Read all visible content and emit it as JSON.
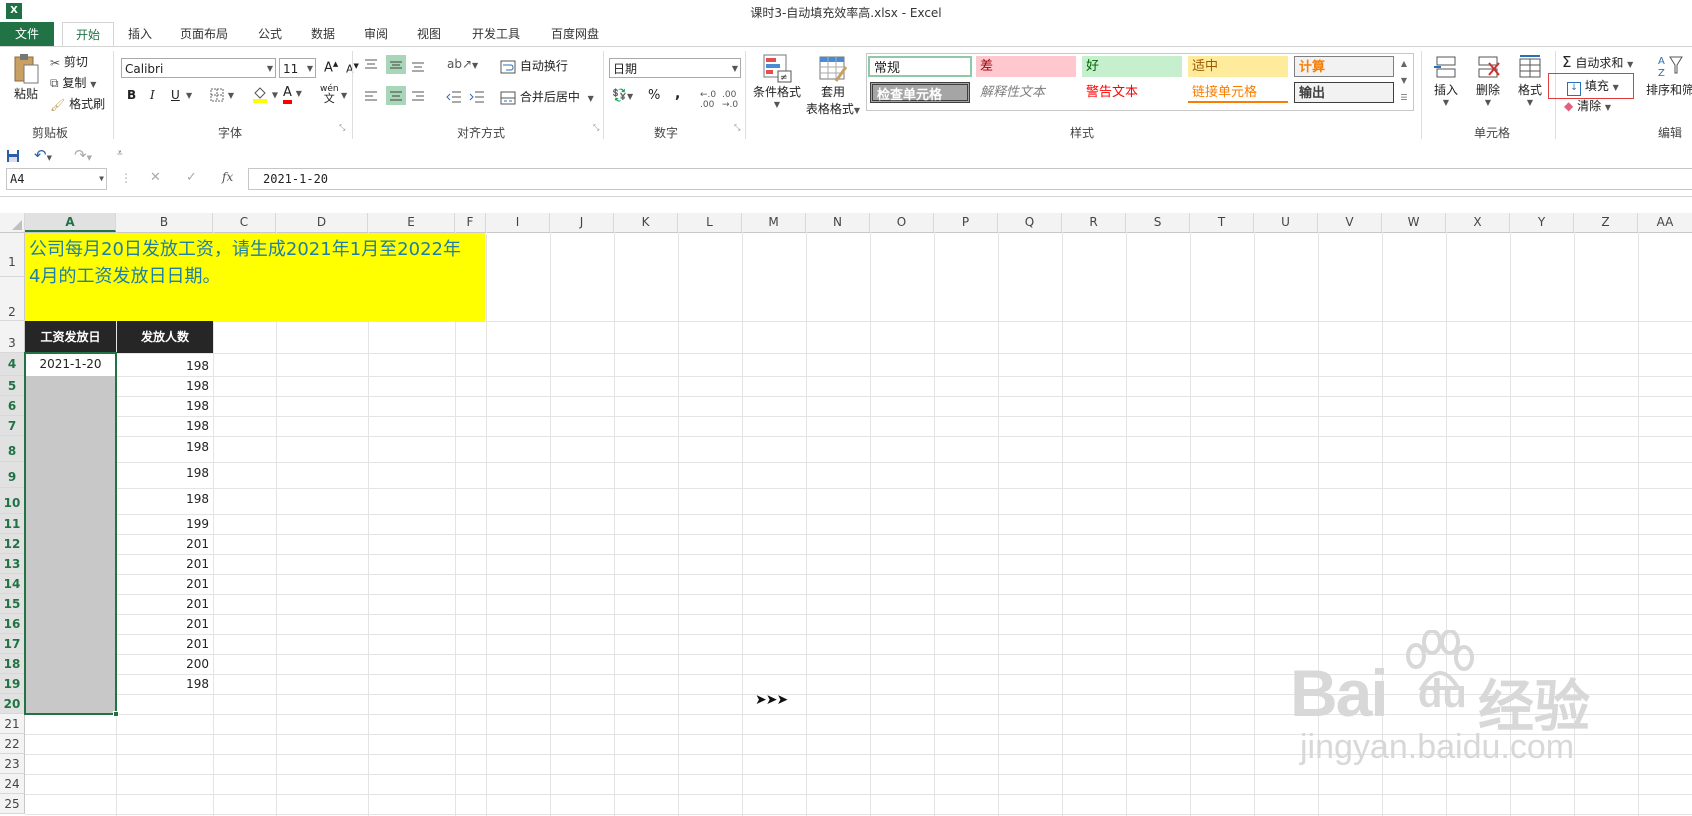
{
  "window": {
    "title": "课时3-自动填充效率高.xlsx - Excel",
    "app_icon": "X"
  },
  "tabs": [
    "文件",
    "开始",
    "插入",
    "页面布局",
    "公式",
    "数据",
    "审阅",
    "视图",
    "开发工具",
    "百度网盘"
  ],
  "ribbon": {
    "clipboard": {
      "paste": "粘贴",
      "cut": "剪切",
      "copy": "复制",
      "format_painter": "格式刷",
      "group": "剪贴板"
    },
    "font": {
      "name": "Calibri",
      "size": "11",
      "bold": "B",
      "italic": "I",
      "underline": "U",
      "grow": "A",
      "shrink": "A",
      "font_color_letter": "A",
      "phonetic": "wén",
      "group": "字体"
    },
    "alignment": {
      "wrap": "自动换行",
      "merge": "合并后居中",
      "group": "对齐方式"
    },
    "number": {
      "format": "日期",
      "percent": "%",
      "comma": ",",
      "group": "数字"
    },
    "styles": {
      "conditional": "条件格式",
      "table_line1": "套用",
      "table_line2": "表格格式",
      "cells": [
        {
          "label": "常规",
          "bg": "#ffffff",
          "fg": "#000000"
        },
        {
          "label": "差",
          "bg": "#ffc7ce",
          "fg": "#9c0006"
        },
        {
          "label": "好",
          "bg": "#c6efce",
          "fg": "#006100"
        },
        {
          "label": "适中",
          "bg": "#ffeb9c",
          "fg": "#9c5700"
        },
        {
          "label": "计算",
          "bg": "#f2f2f2",
          "fg": "#fa7d00"
        },
        {
          "label": "检查单元格",
          "bg": "#a5a5a5",
          "fg": "#ffffff"
        },
        {
          "label": "解释性文本",
          "bg": "#ffffff",
          "fg": "#7f7f7f"
        },
        {
          "label": "警告文本",
          "bg": "#ffffff",
          "fg": "#ff0000"
        },
        {
          "label": "链接单元格",
          "bg": "#ffffff",
          "fg": "#fa7d00"
        },
        {
          "label": "输出",
          "bg": "#f2f2f2",
          "fg": "#3f3f3f"
        }
      ],
      "group": "样式"
    },
    "cells": {
      "insert": "插入",
      "delete": "删除",
      "format": "格式",
      "group": "单元格"
    },
    "editing": {
      "autosum": "自动求和",
      "fill": "填充",
      "clear": "清除",
      "sort": "排序和筛",
      "group": "编辑"
    }
  },
  "formula_bar": {
    "name_box": "A4",
    "fx": "fx",
    "value": "2021-1-20"
  },
  "columns": [
    "A",
    "B",
    "C",
    "D",
    "E",
    "F",
    "I",
    "J",
    "K",
    "L",
    "M",
    "N",
    "O",
    "P",
    "Q",
    "R",
    "S",
    "T",
    "U",
    "V",
    "W",
    "X",
    "Y",
    "Z",
    "AA"
  ],
  "rows": [
    "1",
    "2",
    "3",
    "4",
    "5",
    "6",
    "7",
    "8",
    "9",
    "10",
    "11",
    "12",
    "13",
    "14",
    "15",
    "16",
    "17",
    "18",
    "19",
    "20",
    "21",
    "22",
    "23",
    "24",
    "25"
  ],
  "sheet": {
    "title_line1": "公司每月20日发放工资，请生成2021年1月至2022年",
    "title_line2": "4月的工资发放日日期。",
    "header_a": "工资发放日",
    "header_b": "发放人数",
    "a4": "2021-1-20",
    "counts": [
      "198",
      "198",
      "198",
      "198",
      "198",
      "198",
      "198",
      "199",
      "201",
      "201",
      "201",
      "201",
      "201",
      "201",
      "200",
      "198"
    ],
    "arrow": "➤➤➤"
  },
  "watermark": {
    "brand": "Bai",
    "du": "du",
    "cn": "经验",
    "url": "jingyan.baidu.com"
  },
  "colors": {
    "accent": "#217346",
    "title_bg": "#ffff00",
    "title_fg": "#1f7fa6",
    "header_bg": "#262626",
    "selection": "#c8c8c8",
    "highlight_box": "#e03c3c"
  }
}
